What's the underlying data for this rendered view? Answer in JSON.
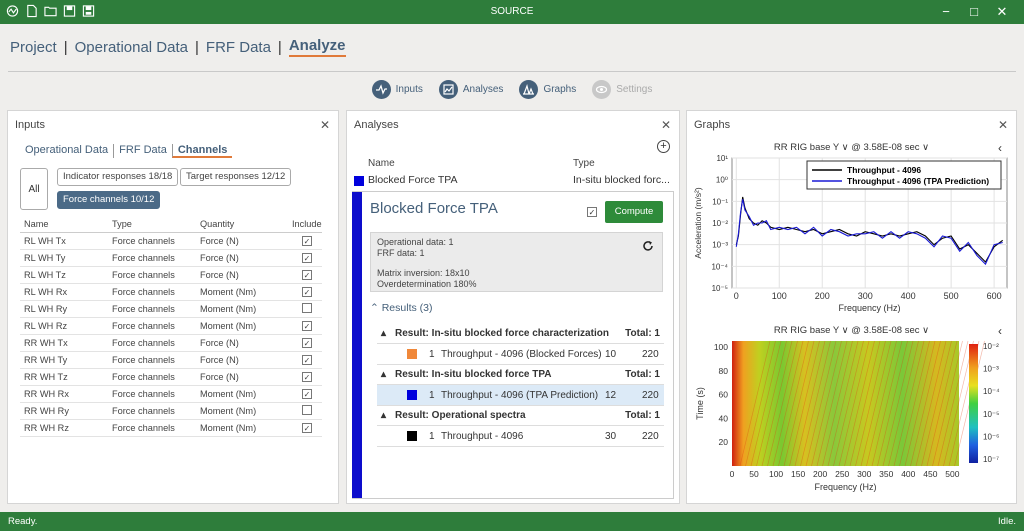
{
  "app": {
    "title": "SOURCE",
    "status_left": "Ready.",
    "status_right": "Idle."
  },
  "nav": {
    "items": [
      "Project",
      "Operational Data",
      "FRF Data",
      "Analyze"
    ]
  },
  "tools": [
    "Inputs",
    "Analyses",
    "Graphs",
    "Settings"
  ],
  "inputs": {
    "title": "Inputs",
    "subtabs": [
      "Operational Data",
      "FRF Data",
      "Channels"
    ],
    "all": "All",
    "chips": [
      "Indicator responses 18/18",
      "Target responses 12/12",
      "Force channels 10/12"
    ],
    "columns": [
      "Name",
      "Type",
      "Quantity",
      "Include"
    ],
    "rows": [
      {
        "name": "RL WH Tx",
        "type": "Force channels",
        "qty": "Force (N)",
        "inc": "✓"
      },
      {
        "name": "RL WH Ty",
        "type": "Force channels",
        "qty": "Force (N)",
        "inc": "✓"
      },
      {
        "name": "RL WH Tz",
        "type": "Force channels",
        "qty": "Force (N)",
        "inc": "✓"
      },
      {
        "name": "RL WH Rx",
        "type": "Force channels",
        "qty": "Moment (Nm)",
        "inc": "✓"
      },
      {
        "name": "RL WH Ry",
        "type": "Force channels",
        "qty": "Moment (Nm)",
        "inc": ""
      },
      {
        "name": "RL WH Rz",
        "type": "Force channels",
        "qty": "Moment (Nm)",
        "inc": "✓"
      },
      {
        "name": "RR WH Tx",
        "type": "Force channels",
        "qty": "Force (N)",
        "inc": "✓"
      },
      {
        "name": "RR WH Ty",
        "type": "Force channels",
        "qty": "Force (N)",
        "inc": "✓"
      },
      {
        "name": "RR WH Tz",
        "type": "Force channels",
        "qty": "Force (N)",
        "inc": "✓"
      },
      {
        "name": "RR WH Rx",
        "type": "Force channels",
        "qty": "Moment (Nm)",
        "inc": "✓"
      },
      {
        "name": "RR WH Ry",
        "type": "Force channels",
        "qty": "Moment (Nm)",
        "inc": ""
      },
      {
        "name": "RR WH Rz",
        "type": "Force channels",
        "qty": "Moment (Nm)",
        "inc": "✓"
      }
    ]
  },
  "analyses": {
    "title": "Analyses",
    "col_name": "Name",
    "col_type": "Type",
    "row_name": "Blocked Force TPA",
    "row_type": "In-situ blocked forc...",
    "detail_title": "Blocked Force TPA",
    "compute": "Compute",
    "info": [
      "Operational data: 1",
      "FRF data: 1",
      "Matrix inversion: 18x10",
      "Overdetermination 180%"
    ],
    "results_header": "Results (3)",
    "groups": [
      {
        "label": "Result: In-situ blocked force characterization",
        "total": "Total: 1",
        "item": {
          "idx": "1",
          "name": "Throughput - 4096 (Blocked Forces)",
          "a": "10",
          "b": "220",
          "color": "#f0883a"
        }
      },
      {
        "label": "Result: In-situ blocked force TPA",
        "total": "Total: 1",
        "item": {
          "idx": "1",
          "name": "Throughput - 4096 (TPA Prediction)",
          "a": "12",
          "b": "220",
          "color": "#0000dd"
        }
      },
      {
        "label": "Result: Operational spectra",
        "total": "Total: 1",
        "item": {
          "idx": "1",
          "name": "Throughput - 4096",
          "a": "30",
          "b": "220",
          "color": "#000000"
        }
      }
    ]
  },
  "graphs": {
    "title": "Graphs",
    "chart_data": [
      {
        "type": "line",
        "title": "RR RIG base Y ∨ @ 3.58E-08 sec ∨",
        "xlabel": "Frequency (Hz)",
        "ylabel": "Acceleration (m/s²)",
        "xticks": [
          "0",
          "100",
          "200",
          "300",
          "400",
          "500",
          "600"
        ],
        "yticks": [
          "10¹",
          "10⁰",
          "10⁻¹",
          "10⁻²",
          "10⁻³",
          "10⁻⁴",
          "10⁻⁵"
        ],
        "ylim_log10": [
          -5,
          1
        ],
        "xlim": [
          -10,
          630
        ],
        "grid": true,
        "legend": "top-right",
        "series": [
          {
            "name": "Throughput - 4096",
            "color": "#000000",
            "x": [
              0,
              5,
              10,
              15,
              20,
              30,
              40,
              50,
              60,
              70,
              80,
              100,
              120,
              140,
              160,
              180,
              200,
              220,
              240,
              260,
              280,
              300,
              320,
              340,
              360,
              380,
              400,
              420,
              440,
              460,
              480,
              500,
              520,
              540,
              560,
              580,
              600,
              620
            ],
            "logy": [
              -3.0,
              -2.6,
              -1.6,
              -0.8,
              -1.3,
              -1.8,
              -2.0,
              -2.1,
              -1.9,
              -2.0,
              -2.2,
              -2.3,
              -2.2,
              -2.3,
              -2.4,
              -2.3,
              -2.5,
              -2.4,
              -2.3,
              -2.5,
              -2.6,
              -2.4,
              -2.5,
              -2.6,
              -2.5,
              -2.6,
              -2.5,
              -2.4,
              -2.6,
              -3.0,
              -2.7,
              -2.6,
              -3.2,
              -3.0,
              -3.4,
              -3.8,
              -3.1,
              -2.8
            ]
          },
          {
            "name": "Throughput - 4096 (TPA Prediction)",
            "color": "#1a1ad6",
            "x": [
              0,
              5,
              10,
              15,
              20,
              30,
              40,
              50,
              60,
              70,
              80,
              100,
              120,
              140,
              160,
              180,
              200,
              220,
              240,
              260,
              280,
              300,
              320,
              340,
              360,
              380,
              400,
              420,
              440,
              460,
              480,
              500,
              520,
              540,
              560,
              580,
              600,
              620
            ],
            "logy": [
              -3.1,
              -2.5,
              -1.5,
              -0.9,
              -1.4,
              -1.7,
              -2.1,
              -2.0,
              -2.0,
              -1.9,
              -2.3,
              -2.2,
              -2.3,
              -2.2,
              -2.5,
              -2.2,
              -2.6,
              -2.3,
              -2.4,
              -2.6,
              -2.5,
              -2.5,
              -2.4,
              -2.7,
              -2.4,
              -2.7,
              -2.4,
              -2.5,
              -2.7,
              -3.1,
              -2.6,
              -2.7,
              -3.3,
              -2.9,
              -3.5,
              -3.9,
              -3.0,
              -2.9
            ]
          }
        ]
      },
      {
        "type": "heatmap",
        "title": "RR RIG base Y ∨ @ 3.58E-08 sec ∨",
        "xlabel": "Frequency (Hz)",
        "ylabel": "Time (s)",
        "xticks": [
          "0",
          "50",
          "100",
          "150",
          "200",
          "250",
          "300",
          "350",
          "400",
          "450",
          "500"
        ],
        "yticks": [
          "100",
          "80",
          "60",
          "40",
          "20"
        ],
        "xlim": [
          0,
          515
        ],
        "ylim": [
          0,
          105
        ],
        "colorbar": [
          "10⁻²",
          "10⁻³",
          "10⁻⁴",
          "10⁻⁵",
          "10⁻⁶",
          "10⁻⁷"
        ]
      }
    ]
  }
}
